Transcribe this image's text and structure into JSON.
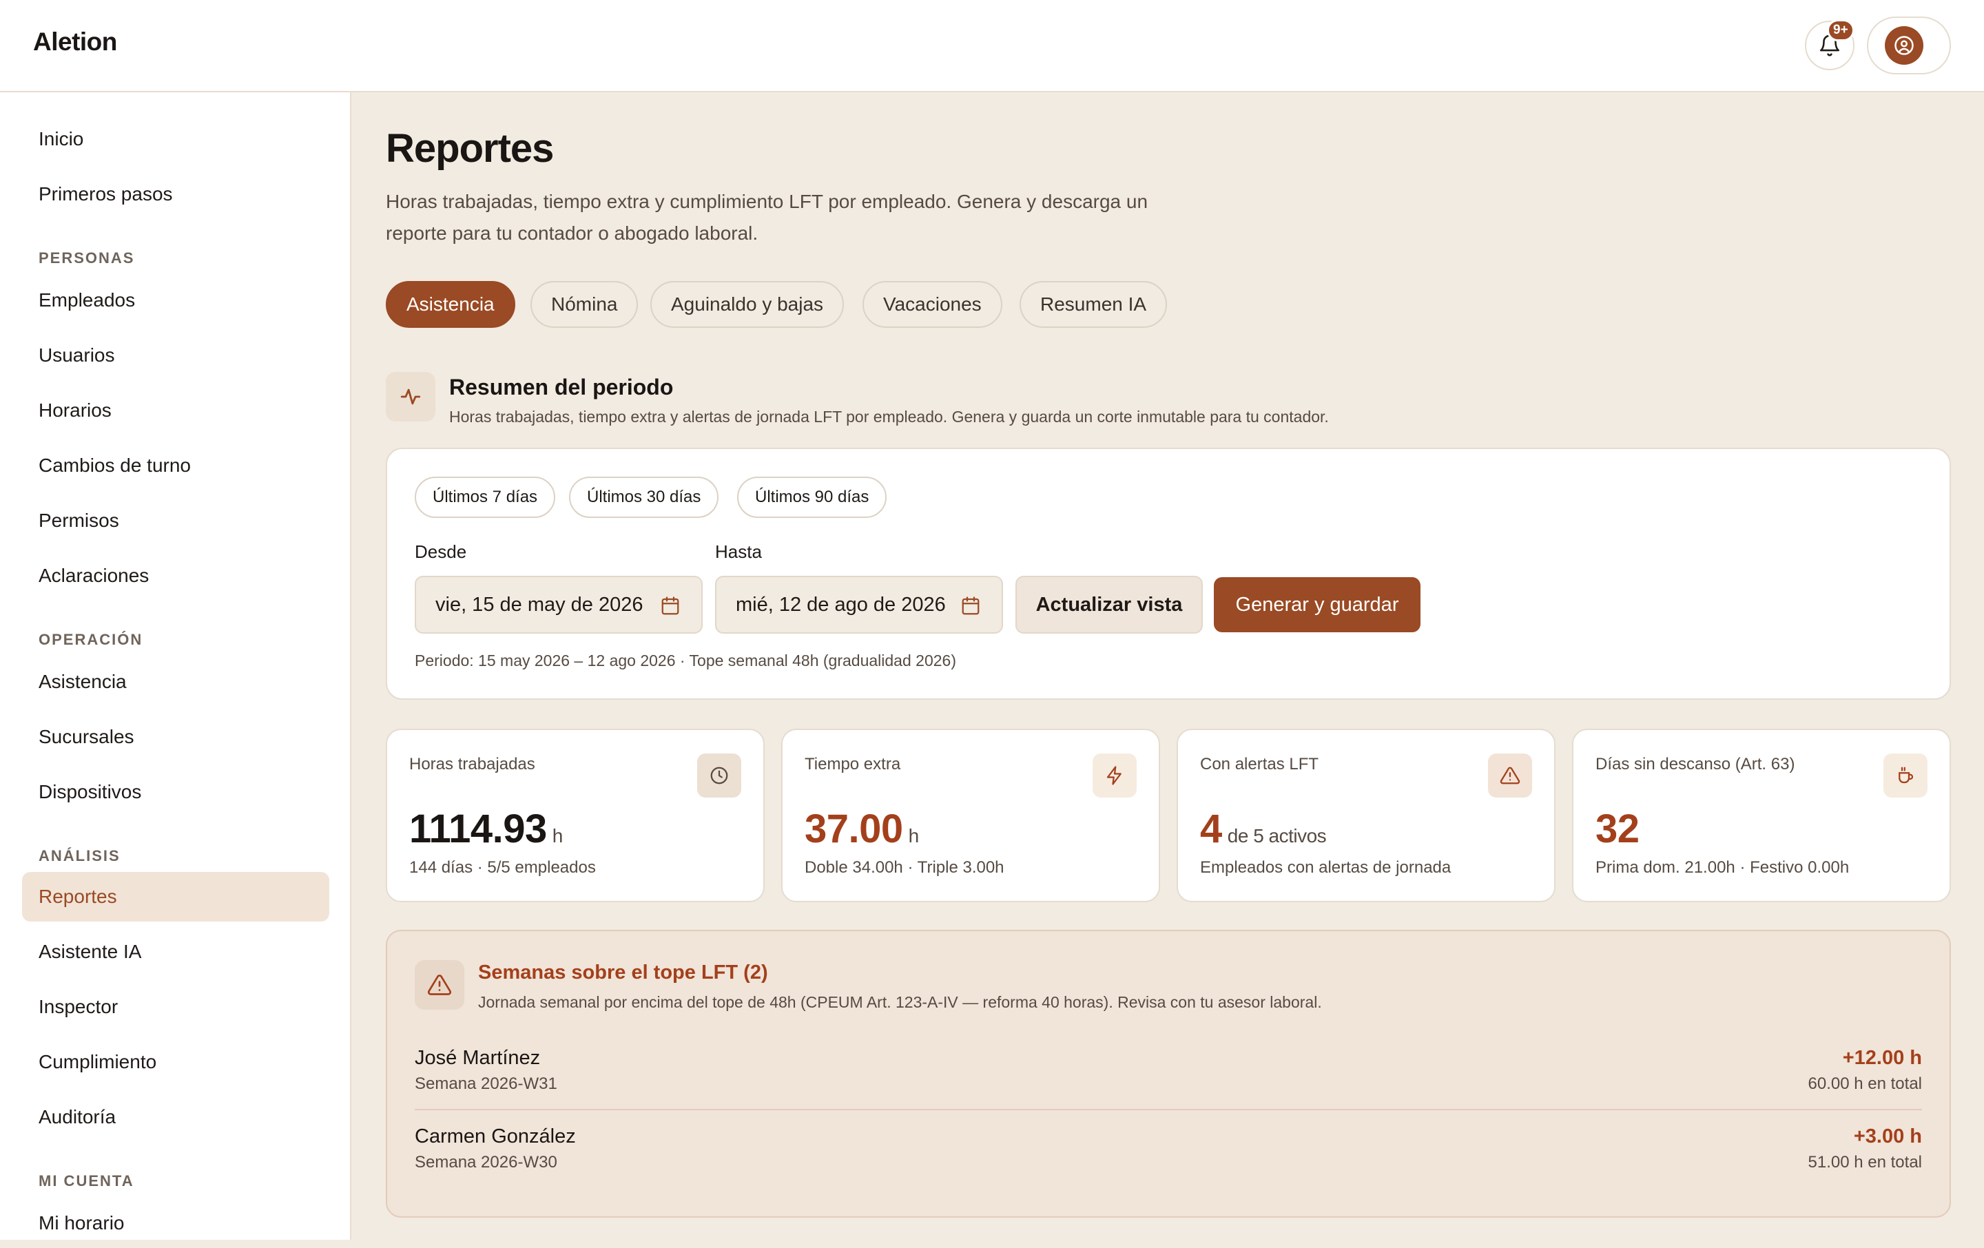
{
  "app": {
    "brand": "Aletion"
  },
  "topbar": {
    "notifications_badge": "9+"
  },
  "sidebar": {
    "items_top": [
      "Inicio",
      "Primeros pasos"
    ],
    "sections": [
      {
        "title": "PERSONAS",
        "items": [
          "Empleados",
          "Usuarios",
          "Horarios",
          "Cambios de turno",
          "Permisos",
          "Aclaraciones"
        ]
      },
      {
        "title": "OPERACIÓN",
        "items": [
          "Asistencia",
          "Sucursales",
          "Dispositivos"
        ]
      },
      {
        "title": "ANÁLISIS",
        "items": [
          "Reportes",
          "Asistente IA",
          "Inspector",
          "Cumplimiento",
          "Auditoría"
        ]
      },
      {
        "title": "MI CUENTA",
        "items": [
          "Mi horario"
        ]
      }
    ],
    "active_item": "Reportes"
  },
  "page": {
    "title": "Reportes",
    "description": "Horas trabajadas, tiempo extra y cumplimiento LFT por empleado. Genera y descarga un reporte para tu contador o abogado laboral."
  },
  "tabs": [
    "Asistencia",
    "Nómina",
    "Aguinaldo y bajas",
    "Vacaciones",
    "Resumen IA"
  ],
  "active_tab": "Asistencia",
  "summary": {
    "title": "Resumen del periodo",
    "subtitle": "Horas trabajadas, tiempo extra y alertas de jornada LFT por empleado. Genera y guarda un corte inmutable para tu contador."
  },
  "filters": {
    "presets": [
      "Últimos 7 días",
      "Últimos 30 días",
      "Últimos 90 días"
    ],
    "from_label": "Desde",
    "from_value": "vie, 15 de may de 2026",
    "to_label": "Hasta",
    "to_value": "mié, 12 de ago de 2026",
    "refresh_label": "Actualizar vista",
    "generate_label": "Generar y guardar",
    "period_note": "Periodo: 15 may 2026 – 12 ago 2026 · Tope semanal 48h (gradualidad 2026)"
  },
  "stats": [
    {
      "label": "Horas trabajadas",
      "value": "1114.93",
      "unit": "h",
      "sub": "144 días · 5/5 empleados",
      "icon": "clock-icon",
      "value_color": "#1a1614"
    },
    {
      "label": "Tiempo extra",
      "value": "37.00",
      "unit": "h",
      "sub": "Doble 34.00h · Triple 3.00h",
      "icon": "lightning-icon",
      "value_color": "#a3401b"
    },
    {
      "label": "Con alertas LFT",
      "value": "4",
      "unit": "de 5 activos",
      "sub": "Empleados con alertas de jornada",
      "icon": "warning-icon",
      "value_color": "#a3401b"
    },
    {
      "label": "Días sin descanso (Art. 63)",
      "value": "32",
      "unit": "",
      "sub": "Prima dom. 21.00h · Festivo 0.00h",
      "icon": "coffee-icon",
      "value_color": "#a3401b"
    }
  ],
  "alerts": {
    "title": "Semanas sobre el tope LFT (2)",
    "subtitle": "Jornada semanal por encima del tope de 48h (CPEUM Art. 123-A-IV — reforma 40 horas). Revisa con tu asesor laboral.",
    "rows": [
      {
        "name": "José Martínez",
        "week": "Semana 2026-W31",
        "extra": "+12.00 h",
        "total": "60.00 h en total"
      },
      {
        "name": "Carmen González",
        "week": "Semana 2026-W30",
        "extra": "+3.00 h",
        "total": "51.00 h en total"
      }
    ]
  },
  "colors": {
    "accent": "#9a4a24",
    "danger_text": "#a3401b",
    "background": "#f2ebe1"
  }
}
